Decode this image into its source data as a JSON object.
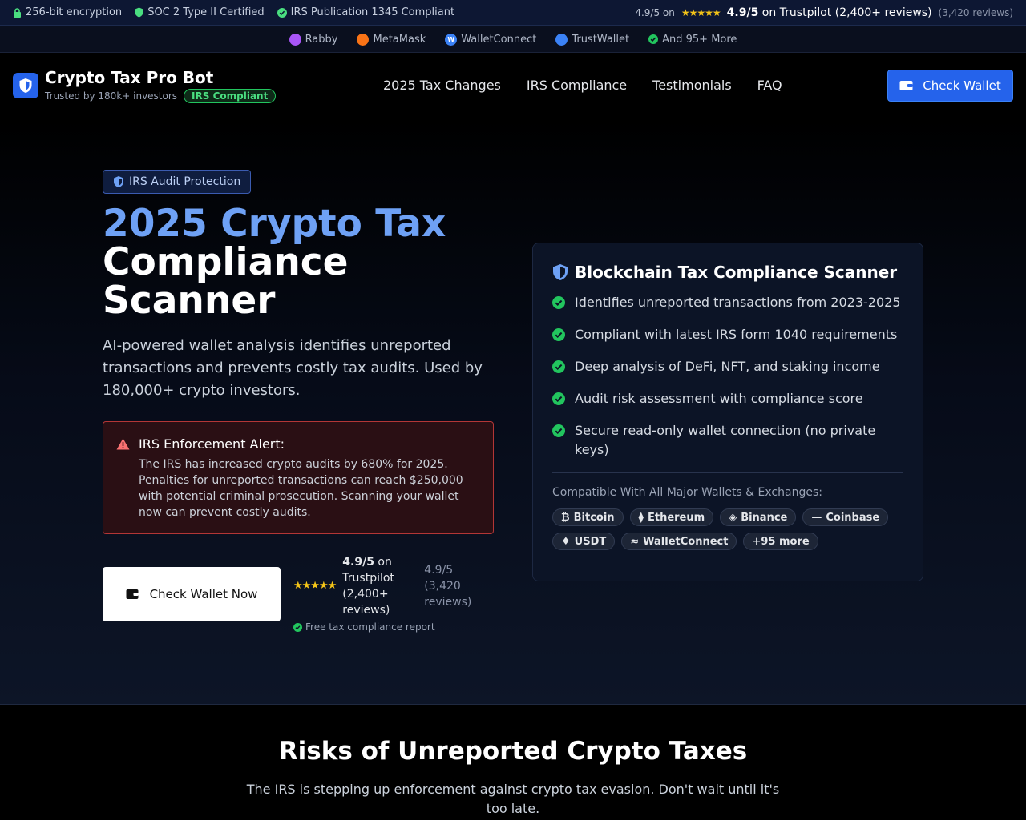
{
  "topbar": {
    "encryption": "256-bit encryption",
    "soc": "SOC 2 Type II Certified",
    "irs": "IRS Publication 1345 Compliant",
    "rating_prefix": "4.9/5 on",
    "rating_score": "4.9/5",
    "rating_text": "on Trustpilot (2,400+ reviews)",
    "rating_extra": "(3,420 reviews)"
  },
  "wallets": [
    {
      "label": "Rabby",
      "color": "#a855f7"
    },
    {
      "label": "MetaMask",
      "color": "#f97316"
    },
    {
      "label": "WalletConnect",
      "color": "#3b82f6"
    },
    {
      "label": "TrustWallet",
      "color": "#3b82f6"
    },
    {
      "label": "And 95+ More",
      "color": "#22c55e"
    }
  ],
  "header": {
    "brand": "Crypto Tax Pro Bot",
    "trusted": "Trusted by 180k+ investors",
    "badge": "IRS Compliant",
    "nav": [
      "2025 Tax Changes",
      "IRS Compliance",
      "Testimonials",
      "FAQ"
    ],
    "check_wallet": "Check Wallet"
  },
  "hero": {
    "pill": "IRS Audit Protection",
    "title_blue": "2025 Crypto Tax",
    "title_white": "Compliance Scanner",
    "lede": "AI-powered wallet analysis identifies unreported transactions and prevents costly tax audits. Used by 180,000+ crypto investors.",
    "alert_title": "IRS Enforcement Alert:",
    "alert_body": "The IRS has increased crypto audits by 680% for 2025. Penalties for unreported transactions can reach $250,000 with potential criminal prosecution. Scanning your wallet now can prevent costly audits.",
    "cta": "Check Wallet Now",
    "rating_score": "4.9/5",
    "rating_text": "on Trustpilot (2,400+ reviews)",
    "rating_extra": "4.9/5 (3,420 reviews)",
    "free": "Free tax compliance report"
  },
  "card": {
    "title": "Blockchain Tax Compliance Scanner",
    "features": [
      "Identifies unreported transactions from 2023-2025",
      "Compliant with latest IRS form 1040 requirements",
      "Deep analysis of DeFi, NFT, and staking income",
      "Audit risk assessment with compliance score",
      "Secure read-only wallet connection (no private keys)"
    ],
    "compat_label": "Compatible With All Major Wallets & Exchanges:",
    "tags": [
      {
        "label": "Bitcoin",
        "icon": "₿"
      },
      {
        "label": "Ethereum",
        "icon": "⧫"
      },
      {
        "label": "Binance",
        "icon": "◈"
      },
      {
        "label": "Coinbase",
        "icon": "—"
      },
      {
        "label": "USDT",
        "icon": "♦"
      },
      {
        "label": "WalletConnect",
        "icon": "≈"
      },
      {
        "label": "+95 more",
        "icon": ""
      }
    ]
  },
  "risks": {
    "title": "Risks of Unreported Crypto Taxes",
    "subtitle": "The IRS is stepping up enforcement against crypto tax evasion. Don't wait until it's too late."
  },
  "colors": {
    "accent": "#2563eb",
    "accent_light": "#6ea1f5",
    "success": "#22c55e",
    "danger": "#ef4444",
    "star": "#f5c518"
  }
}
